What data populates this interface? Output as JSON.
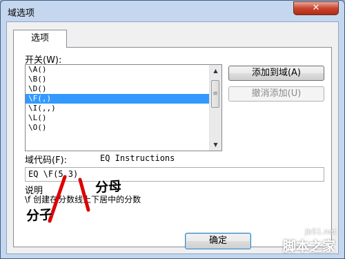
{
  "window": {
    "title": "域选项",
    "close_glyph": "✕"
  },
  "tabs": [
    {
      "label": "选项"
    }
  ],
  "switches": {
    "label": "开关(W):",
    "items": [
      "\\A()",
      "\\B()",
      "\\D()",
      "\\F(,)",
      "\\I(,,)",
      "\\L()",
      "\\O()"
    ],
    "selected_index": 3
  },
  "buttons": {
    "add_label": "添加到域(A)",
    "undo_label": "撤消添加(U)",
    "ok_label": "确定"
  },
  "field_code": {
    "label": "域代码(F):",
    "instructions_label": "EQ Instructions",
    "value": "EQ \\F(5,3)"
  },
  "description": {
    "label": "说明",
    "text": "\\f 创建在分数线上下居中的分数"
  },
  "annotations": {
    "denominator": "分母",
    "numerator": "分子",
    "color": "#dd0000"
  },
  "watermark": {
    "site": "jb51.net",
    "name": "脚本之家"
  }
}
